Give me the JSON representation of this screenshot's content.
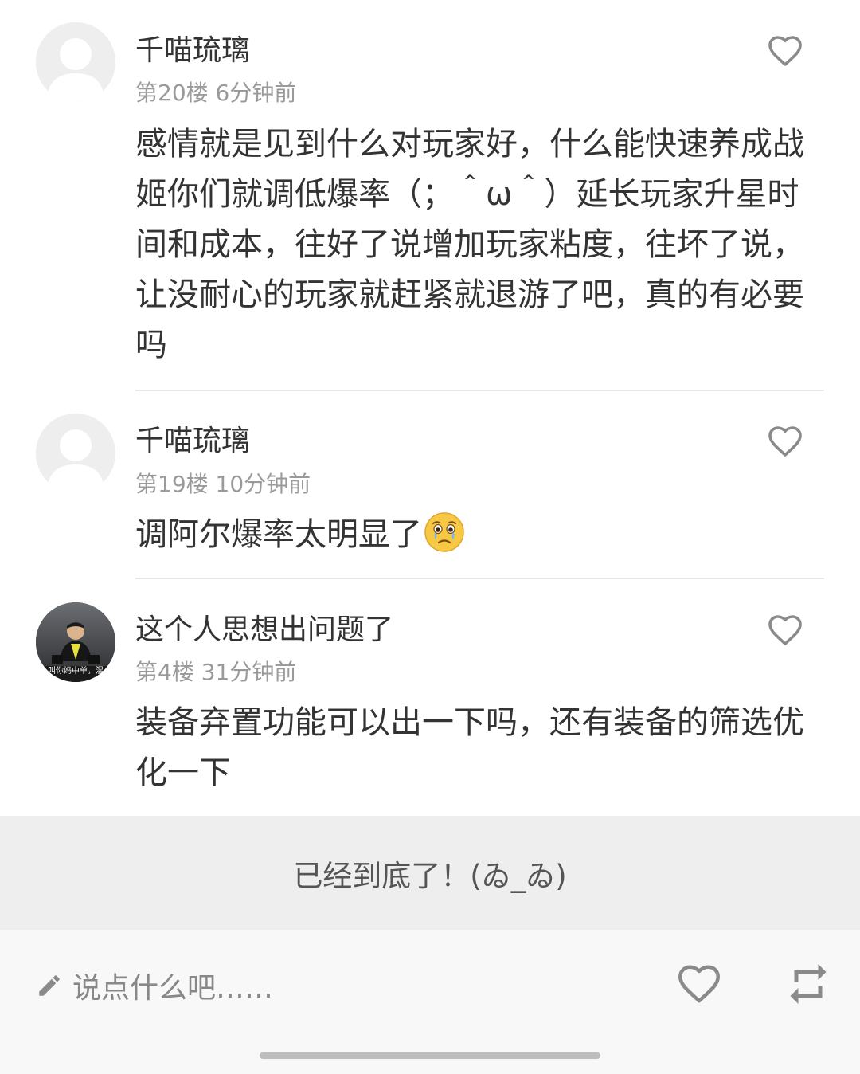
{
  "comments": [
    {
      "username": "千喵琉璃",
      "floor": "第20楼",
      "time": "6分钟前",
      "body": "感情就是见到什么对玩家好，什么能快速养成战姬你们就调低爆率（；＾ω＾）延长玩家升星时间和成本，往好了说增加玩家粘度，往坏了说，让没耐心的玩家就赶紧就退游了吧，真的有必要吗",
      "avatar": "default-avatar"
    },
    {
      "username": "千喵琉璃",
      "floor": "第19楼",
      "time": "10分钟前",
      "body": "调阿尔爆率太明显了",
      "emoji": "crying-face-emoji",
      "avatar": "default-avatar"
    },
    {
      "username": "这个人思想出问题了",
      "floor": "第4楼",
      "time": "31分钟前",
      "body": "装备弃置功能可以出一下吗，还有装备的筛选优化一下",
      "avatar": "photo-avatar",
      "avatar_caption": "叫你妈中单，混"
    }
  ],
  "end_message": "已经到底了！(ゐ_ゐ)",
  "bottom_bar": {
    "placeholder": "说点什么吧……",
    "like_icon": "heart-outline-icon",
    "repost_icon": "repeat-icon"
  },
  "colors": {
    "text_primary": "#333333",
    "text_meta": "#9a9a9a",
    "icon_gray": "#8a8a8a",
    "banner_bg": "#eeeeee"
  }
}
